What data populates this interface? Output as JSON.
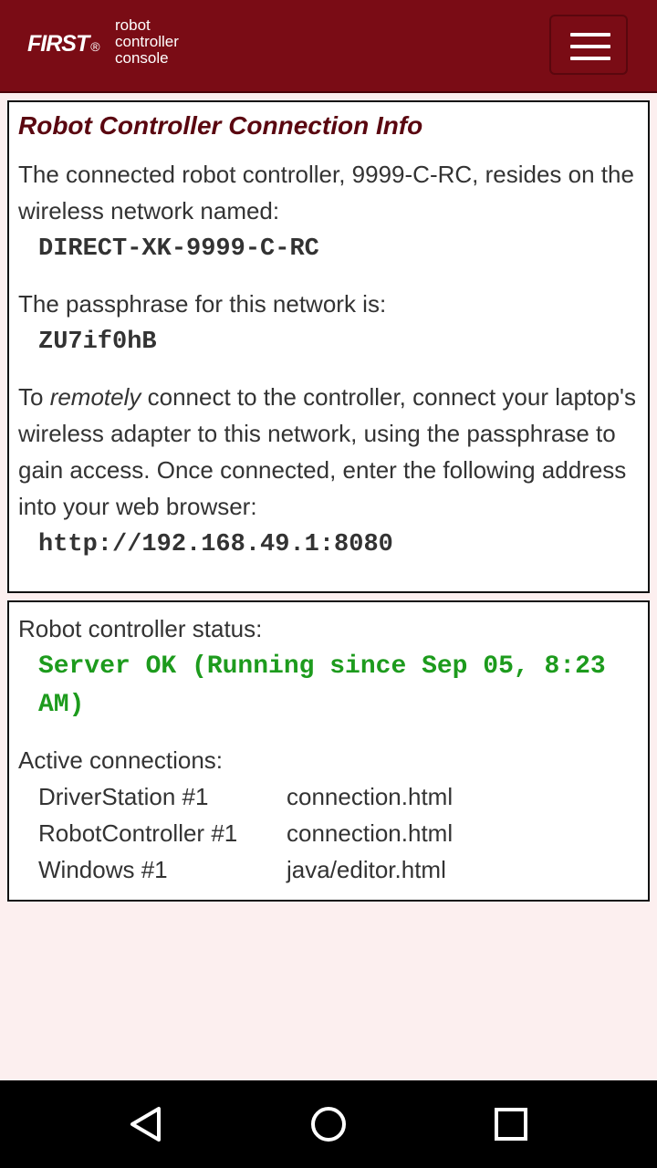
{
  "header": {
    "logo_first": "FIRST",
    "logo_reg": "®",
    "logo_lines": [
      "robot",
      "controller",
      "console"
    ]
  },
  "connection_info": {
    "title": "Robot Controller Connection Info",
    "intro": "The connected robot controller, 9999-C-RC, resides on the wireless network named:",
    "network_name": "DIRECT-XK-9999-C-RC",
    "passphrase_label": "The passphrase for this network is:",
    "passphrase": "ZU7if0hB",
    "remote_prefix": "To ",
    "remote_emphasis": "remotely",
    "remote_rest": " connect to the controller, connect your laptop's wireless adapter to this network, using the passphrase to gain access. Once connected, enter the following address into your web browser:",
    "address": "http://192.168.49.1:8080"
  },
  "status": {
    "label": "Robot controller status:",
    "value": "Server OK (Running since Sep 05, 8:23 AM)",
    "value_color": "#1d9b1d",
    "connections_label": "Active connections:",
    "connections": [
      {
        "name": "DriverStation #1",
        "page": "connection.html"
      },
      {
        "name": "RobotController #1",
        "page": "connection.html"
      },
      {
        "name": "Windows #1",
        "page": "java/editor.html"
      }
    ]
  },
  "navbar": {
    "buttons": [
      "back-icon",
      "home-icon",
      "recents-icon"
    ]
  },
  "colors": {
    "header_bg": "#7a0c15",
    "title": "#5a0710",
    "page_bg": "#fcefef"
  }
}
